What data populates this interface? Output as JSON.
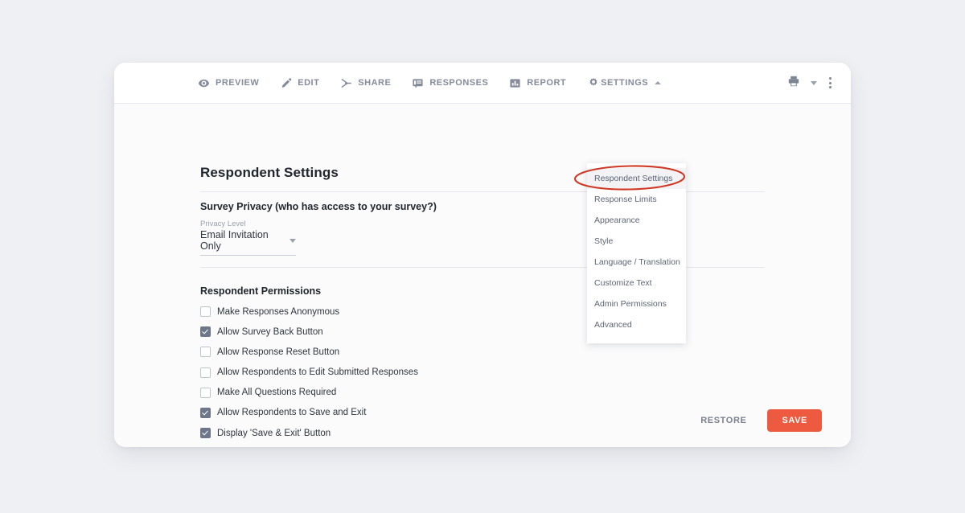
{
  "toolbar": {
    "nav": [
      {
        "label": "PREVIEW",
        "icon": "eye-icon"
      },
      {
        "label": "EDIT",
        "icon": "pencil-icon"
      },
      {
        "label": "SHARE",
        "icon": "share-icon"
      },
      {
        "label": "RESPONSES",
        "icon": "speech-bubble-icon"
      },
      {
        "label": "REPORT",
        "icon": "bar-chart-icon"
      },
      {
        "label": "SETTINGS",
        "icon": "gear-icon"
      }
    ],
    "right": {
      "print_icon": "printer-icon",
      "caret_icon": "chevron-down-icon",
      "more_icon": "kebab-menu-icon"
    }
  },
  "dropdown": {
    "items": [
      "Respondent Settings",
      "Response Limits",
      "Appearance",
      "Style",
      "Language / Translation",
      "Customize Text",
      "Admin Permissions",
      "Advanced"
    ],
    "active_index": 0
  },
  "main": {
    "title": "Respondent Settings",
    "privacy": {
      "heading": "Survey Privacy (who has access to your survey?)",
      "field_label": "Privacy Level",
      "value": "Email Invitation Only"
    },
    "permissions": {
      "heading": "Respondent Permissions",
      "items": [
        {
          "label": "Make Responses Anonymous",
          "checked": false
        },
        {
          "label": "Allow Survey Back Button",
          "checked": true
        },
        {
          "label": "Allow Response Reset Button",
          "checked": false
        },
        {
          "label": "Allow Respondents to Edit Submitted Responses",
          "checked": false
        },
        {
          "label": "Make All Questions Required",
          "checked": false
        },
        {
          "label": "Allow Respondents to Save and Exit",
          "checked": true
        },
        {
          "label": "Display 'Save & Exit' Button",
          "checked": true
        }
      ]
    }
  },
  "footer": {
    "restore_label": "RESTORE",
    "save_label": "SAVE"
  },
  "colors": {
    "accent": "#ee5a3f",
    "annotation": "#cf3a24",
    "page_bg": "#eff0f4",
    "checkbox_on": "#6d7789"
  }
}
